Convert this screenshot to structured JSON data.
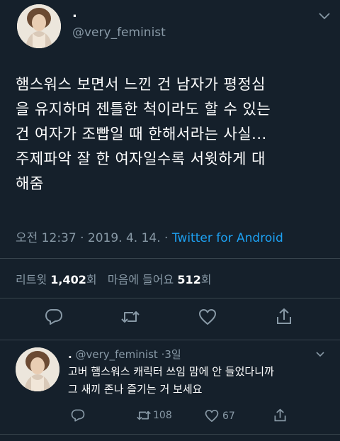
{
  "main_tweet": {
    "display_name": ".",
    "handle": "@very_feminist",
    "text_lines": [
      "햄스워스 보면서 느낀 건 남자가 평정심",
      "을 유지하며 젠틀한 척이라도 할 수 있는",
      "건 여자가 조빱일 때 한해서라는 사실...",
      "주제파악 잘 한 여자일수록 서윗하게 대",
      "해줌"
    ],
    "time": "오전 12:37",
    "separator": "·",
    "date": "2019. 4. 14.",
    "source": "Twitter for Android",
    "retweets_label": "리트윗",
    "retweets_count": "1,402",
    "retweets_unit": "회",
    "likes_label": "마음에 들어요",
    "likes_count": "512",
    "likes_unit": "회"
  },
  "reply_tweet": {
    "display_name": ".",
    "handle": "@very_feminist",
    "separator": "·",
    "age": "3일",
    "text_lines": [
      "고버 햄스워스 캐릭터 쓰임 맘에 안 들었다니까",
      "그 새끼 존나 즐기는 거 보세요"
    ],
    "retweet_count": "108",
    "like_count": "67"
  },
  "colors": {
    "background": "#15202b",
    "text": "#ffffff",
    "muted": "#8899a6",
    "accent": "#1da1f2",
    "divider": "#38444d"
  },
  "icons": [
    "avatar",
    "chevron-down-icon",
    "reply-icon",
    "retweet-icon",
    "like-icon",
    "share-icon"
  ]
}
